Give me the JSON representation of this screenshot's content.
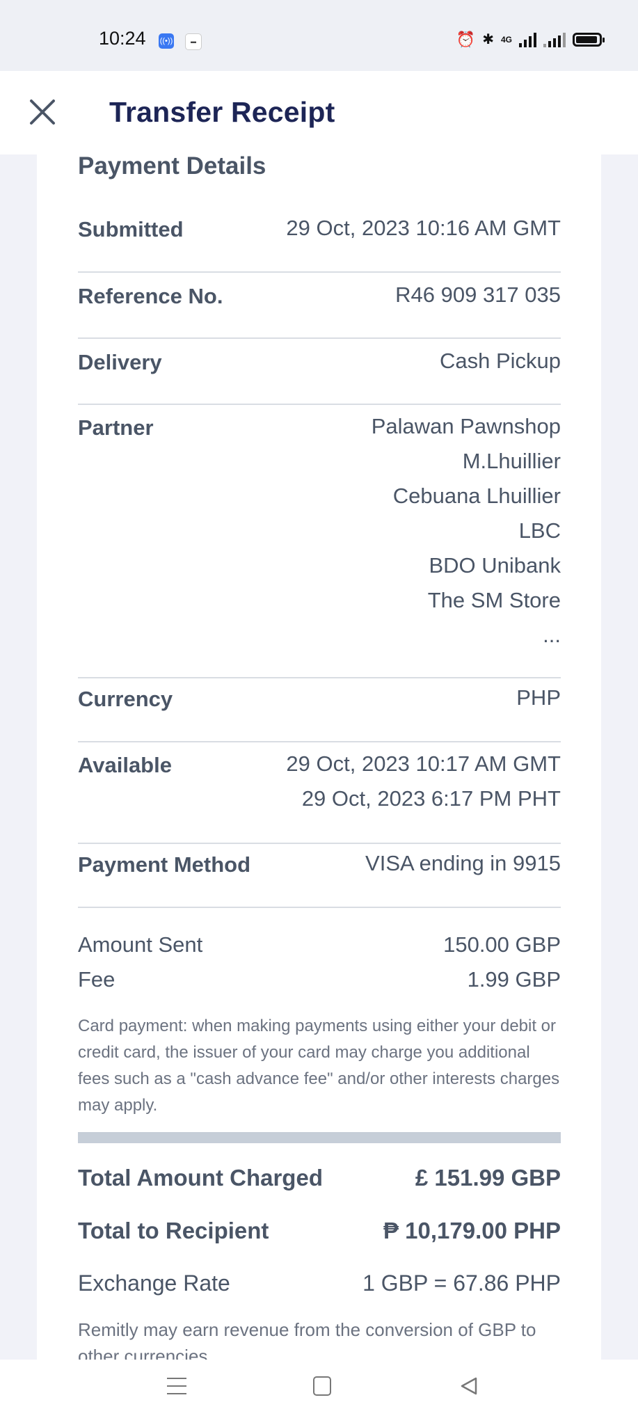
{
  "status_bar": {
    "time": "10:24",
    "network": "4G",
    "icons": [
      "nfc-icon",
      "app-icon",
      "alarm-icon",
      "bluetooth-icon",
      "signal-icon",
      "battery-icon"
    ]
  },
  "header": {
    "title": "Transfer Receipt",
    "close_icon": "close-icon"
  },
  "payment_details": {
    "title": "Payment Details",
    "submitted": {
      "label": "Submitted",
      "value": "29 Oct, 2023 10:16 AM GMT"
    },
    "reference": {
      "label": "Reference No.",
      "value": "R46 909 317 035"
    },
    "delivery": {
      "label": "Delivery",
      "value": "Cash Pickup"
    },
    "partner": {
      "label": "Partner",
      "values": [
        "Palawan Pawnshop",
        "M.Lhuillier",
        "Cebuana Lhuillier",
        "LBC",
        "BDO Unibank",
        "The SM Store",
        "..."
      ]
    },
    "currency": {
      "label": "Currency",
      "value": "PHP"
    },
    "available": {
      "label": "Available",
      "values": [
        "29 Oct, 2023 10:17 AM GMT",
        "29 Oct, 2023 6:17 PM PHT"
      ]
    },
    "payment_method": {
      "label": "Payment Method",
      "value": "VISA ending in 9915"
    }
  },
  "amounts": {
    "amount_sent": {
      "label": "Amount Sent",
      "value": "150.00 GBP"
    },
    "fee": {
      "label": "Fee",
      "value": "1.99 GBP"
    },
    "card_note": "Card payment: when making payments using either your debit or credit card, the issuer of your card may charge you additional fees such as a \"cash advance fee\" and/or other interests charges may apply."
  },
  "totals": {
    "total_charged": {
      "label": "Total Amount Charged",
      "value": "£ 151.99 GBP"
    },
    "total_recipient": {
      "label": "Total to Recipient",
      "value": "₱ 10,179.00 PHP"
    },
    "exchange_rate": {
      "label": "Exchange Rate",
      "value": "1 GBP = 67.86 PHP"
    },
    "fx_note": "Remitly may earn revenue from the conversion of GBP to other currencies."
  },
  "nav_bar": {
    "icons": [
      "menu-icon",
      "home-icon",
      "back-icon"
    ]
  },
  "colors": {
    "title": "#1d2556",
    "text": "#4a5566",
    "muted": "#6b7280",
    "background": "#f1f2f8",
    "divider_bar": "#c6ced8"
  }
}
